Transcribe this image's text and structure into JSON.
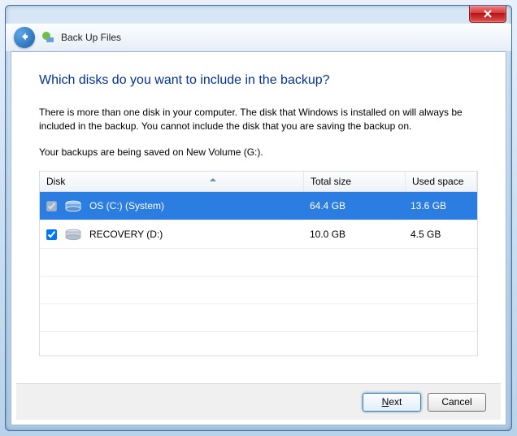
{
  "window": {
    "title": "Back Up Files"
  },
  "page": {
    "heading": "Which disks do you want to include in the backup?",
    "description": "There is more than one disk in your computer. The disk that Windows is installed on will always be included in the backup. You cannot include the disk that you are saving the backup on.",
    "save_location": "Your backups are being saved on New Volume (G:)."
  },
  "table": {
    "headers": {
      "disk": "Disk",
      "total": "Total size",
      "used": "Used space"
    },
    "rows": [
      {
        "name": "OS (C:) (System)",
        "total": "64.4 GB",
        "used": "13.6 GB",
        "checked": true,
        "selected": true,
        "disabled": true
      },
      {
        "name": "RECOVERY (D:)",
        "total": "10.0 GB",
        "used": "4.5 GB",
        "checked": true,
        "selected": false,
        "disabled": false
      }
    ]
  },
  "buttons": {
    "next": "Next",
    "cancel": "Cancel"
  }
}
